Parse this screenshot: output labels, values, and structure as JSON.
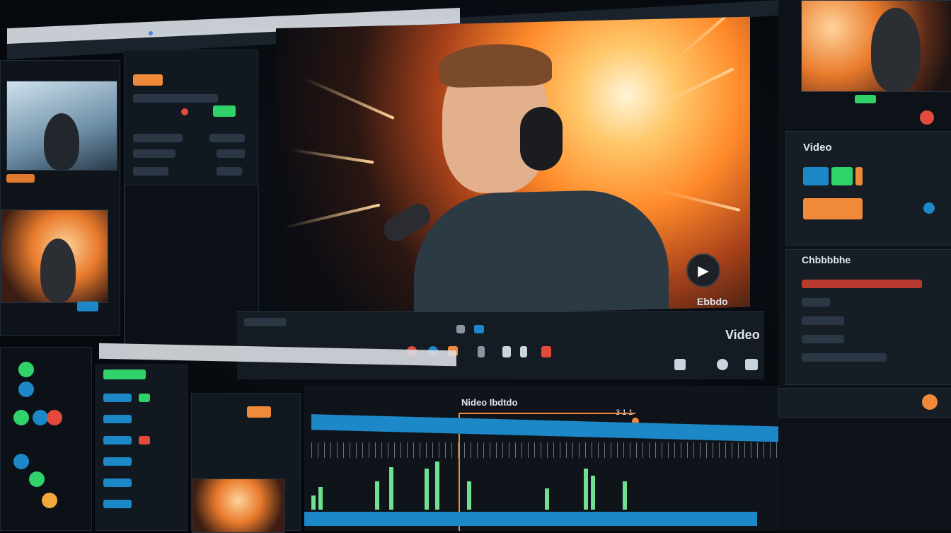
{
  "viewer": {
    "overlay_label": "Ebbdo",
    "play_icon": "play-icon"
  },
  "transport": {
    "video_label": "Video"
  },
  "timeline": {
    "clip_title": "Nideo Ibdtdo",
    "timecode": "3 1 1"
  },
  "right_panel": {
    "section_title": "Video",
    "subsection_title": "Chbbbbhe"
  },
  "colors": {
    "accent_blue": "#1d88c8",
    "accent_orange": "#f08a3a",
    "accent_green": "#2fd36a",
    "accent_red": "#e24b3b"
  }
}
